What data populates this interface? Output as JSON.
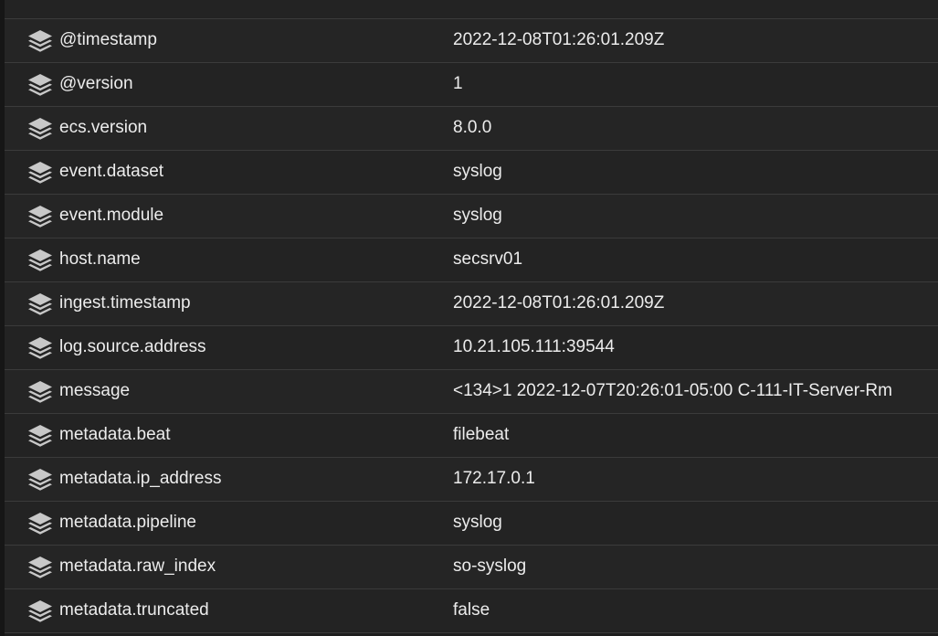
{
  "fields": [
    {
      "name": "@timestamp",
      "value": "2022-12-08T01:26:01.209Z",
      "icon": "layers-icon"
    },
    {
      "name": "@version",
      "value": "1",
      "icon": "layers-icon"
    },
    {
      "name": "ecs.version",
      "value": "8.0.0",
      "icon": "layers-icon"
    },
    {
      "name": "event.dataset",
      "value": "syslog",
      "icon": "layers-icon"
    },
    {
      "name": "event.module",
      "value": "syslog",
      "icon": "layers-icon"
    },
    {
      "name": "host.name",
      "value": "secsrv01",
      "icon": "layers-icon"
    },
    {
      "name": "ingest.timestamp",
      "value": "2022-12-08T01:26:01.209Z",
      "icon": "layers-icon"
    },
    {
      "name": "log.source.address",
      "value": "10.21.105.111:39544",
      "icon": "layers-icon"
    },
    {
      "name": "message",
      "value": "<134>1 2022-12-07T20:26:01-05:00 C-111-IT-Server-Rm",
      "icon": "layers-icon"
    },
    {
      "name": "metadata.beat",
      "value": "filebeat",
      "icon": "layers-icon"
    },
    {
      "name": "metadata.ip_address",
      "value": "172.17.0.1",
      "icon": "layers-icon"
    },
    {
      "name": "metadata.pipeline",
      "value": "syslog",
      "icon": "layers-icon"
    },
    {
      "name": "metadata.raw_index",
      "value": "so-syslog",
      "icon": "layers-icon"
    },
    {
      "name": "metadata.truncated",
      "value": "false",
      "icon": "layers-icon"
    }
  ],
  "colors": {
    "background": "#1e1e1e",
    "row_divider": "#3b3b3b",
    "text": "#ececec",
    "icon": "#c8c8c8"
  }
}
